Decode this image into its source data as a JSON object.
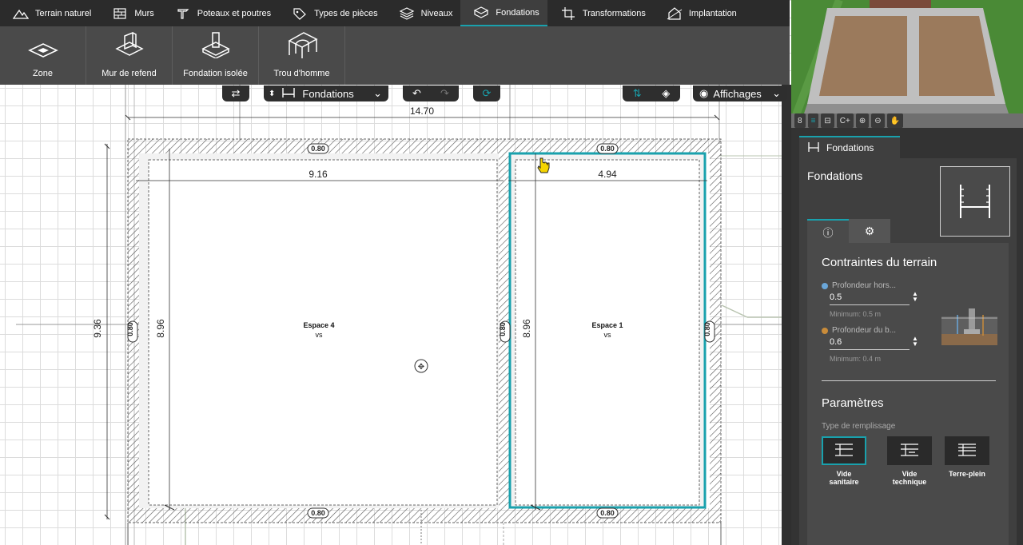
{
  "colors": {
    "accent": "#19a1ad",
    "toolbar_dark": "#2b2b2b",
    "toolbar_mid": "#4a4a4a",
    "panel_bg": "#3f3f3f",
    "selection": "#19a1ad",
    "dot_blue": "#6aa6d8",
    "dot_orange": "#c98c3a"
  },
  "tabs": [
    {
      "label": "Terrain naturel",
      "icon": "terrain-icon"
    },
    {
      "label": "Murs",
      "icon": "wall-icon"
    },
    {
      "label": "Poteaux et poutres",
      "icon": "beam-icon"
    },
    {
      "label": "Types de pièces",
      "icon": "tag-icon"
    },
    {
      "label": "Niveaux",
      "icon": "levels-icon"
    },
    {
      "label": "Fondations",
      "icon": "foundation-icon",
      "active": true
    },
    {
      "label": "Transformations",
      "icon": "transform-icon"
    },
    {
      "label": "Implantation",
      "icon": "implantation-icon"
    }
  ],
  "tools": [
    {
      "label": "Zone",
      "icon": "zone-icon"
    },
    {
      "label": "Mur de refend",
      "icon": "inner-wall-icon"
    },
    {
      "label": "Fondation isolée",
      "icon": "isolated-footing-icon"
    },
    {
      "label": "Trou d'homme",
      "icon": "manhole-icon"
    }
  ],
  "canvas_controls": {
    "layer_select": "Fondations",
    "display_menu": "Affichages"
  },
  "plan": {
    "dim_total_width": "14.70",
    "dim_height_outer": "9.36",
    "dim_left_inner_width": "9.16",
    "dim_right_inner_width": "4.94",
    "dim_inner_height_left": "8.96",
    "dim_inner_height_right": "8.96",
    "wall_thickness": "0.80",
    "rooms": [
      {
        "name": "Espace 4",
        "code": "vs"
      },
      {
        "name": "Espace 1",
        "code": "vs"
      }
    ]
  },
  "preview_toolbar": [
    "8",
    "≡",
    "⊟",
    "C+",
    "⊕",
    "⊖",
    "✋"
  ],
  "panel": {
    "tab_label": "Fondations",
    "title": "Fondations",
    "section1_title": "Contraintes du terrain",
    "field1_label": "Profondeur hors...",
    "field1_value": "0.5",
    "field1_hint": "Minimum: 0.5 m",
    "field2_label": "Profondeur du b...",
    "field2_value": "0.6",
    "field2_hint": "Minimum: 0.4 m",
    "section2_title": "Paramètres",
    "fill_type_label": "Type de remplissage",
    "fill_options": [
      {
        "label": "Vide sanitaire",
        "active": true
      },
      {
        "label": "Vide technique",
        "active": false
      },
      {
        "label": "Terre-plein",
        "active": false
      }
    ]
  }
}
